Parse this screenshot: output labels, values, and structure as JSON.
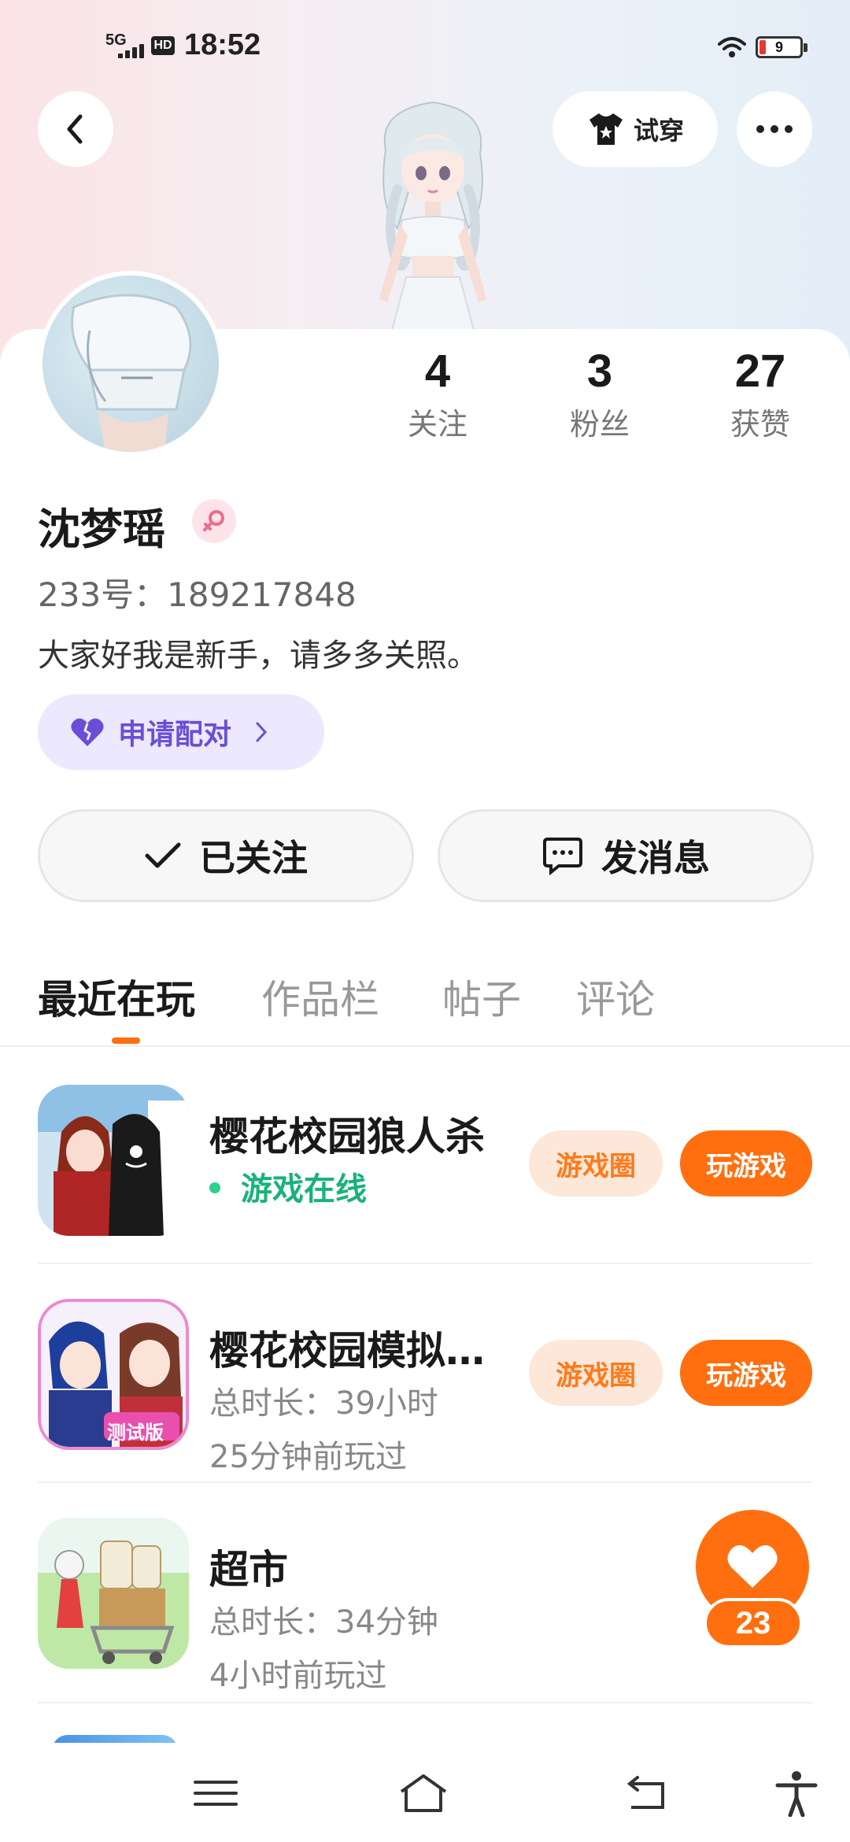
{
  "status_bar": {
    "network": "5G",
    "hd": "HD",
    "time": "18:52",
    "battery": "9"
  },
  "header": {
    "try_on_label": "试穿"
  },
  "profile": {
    "stats": [
      {
        "num": "4",
        "label": "关注"
      },
      {
        "num": "3",
        "label": "粉丝"
      },
      {
        "num": "27",
        "label": "获赞"
      }
    ],
    "name": "沈梦瑶",
    "uid": "233号：189217848",
    "bio": "大家好我是新手，请多多关照。",
    "pair_label": "申请配对"
  },
  "actions": {
    "follow_label": "已关注",
    "message_label": "发消息"
  },
  "tabs": [
    {
      "label": "最近在玩",
      "active": true
    },
    {
      "label": "作品栏",
      "active": false
    },
    {
      "label": "帖子",
      "active": false
    },
    {
      "label": "评论",
      "active": false
    }
  ],
  "games": [
    {
      "title": "樱花校园狼人杀",
      "status": "游戏在线",
      "circle_label": "游戏圈",
      "play_label": "玩游戏"
    },
    {
      "title": "樱花校园模拟…",
      "duration": "总时长：39小时",
      "last_played": "25分钟前玩过",
      "icon_badge": "测试版",
      "circle_label": "游戏圈",
      "play_label": "玩游戏"
    },
    {
      "title": "超市",
      "duration": "总时长：34分钟",
      "last_played": "4小时前玩过"
    }
  ],
  "floating_like": {
    "count": "23"
  },
  "colors": {
    "accent": "#ff6f0f",
    "pair_bg": "#ece8fd",
    "pair_text": "#6a4fd6",
    "online": "#19b37a"
  },
  "icons": {
    "back": "back-arrow-icon",
    "more": "more-dots-icon",
    "try_on": "shirt-icon",
    "gender": "female-icon",
    "pair": "heart-icon",
    "follow": "check-icon",
    "message": "chat-bubble-icon",
    "like": "heart-icon",
    "nav": [
      "menu-icon",
      "home-icon",
      "back-icon",
      "accessibility-icon"
    ]
  }
}
